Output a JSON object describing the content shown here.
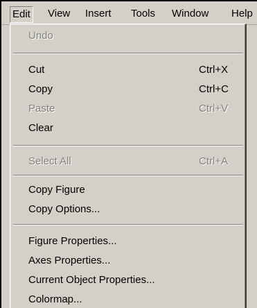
{
  "menubar": {
    "items": [
      {
        "label": "Edit"
      },
      {
        "label": "View"
      },
      {
        "label": "Insert"
      },
      {
        "label": "Tools"
      },
      {
        "label": "Window"
      },
      {
        "label": "Help"
      }
    ]
  },
  "edit_menu": {
    "undo": {
      "label": "Undo",
      "enabled": false
    },
    "cut": {
      "label": "Cut",
      "shortcut": "Ctrl+X",
      "enabled": true
    },
    "copy": {
      "label": "Copy",
      "shortcut": "Ctrl+C",
      "enabled": true
    },
    "paste": {
      "label": "Paste",
      "shortcut": "Ctrl+V",
      "enabled": false
    },
    "clear": {
      "label": "Clear",
      "enabled": true
    },
    "select_all": {
      "label": "Select All",
      "shortcut": "Ctrl+A",
      "enabled": false
    },
    "copy_figure": {
      "label": "Copy Figure",
      "enabled": true
    },
    "copy_options": {
      "label": "Copy Options...",
      "enabled": true
    },
    "figure_properties": {
      "label": "Figure Properties...",
      "enabled": true
    },
    "axes_properties": {
      "label": "Axes Properties...",
      "enabled": true
    },
    "current_object_properties": {
      "label": "Current Object Properties...",
      "enabled": true
    },
    "colormap": {
      "label": "Colormap...",
      "enabled": true
    }
  },
  "colors": {
    "menu_background": "#d4d0c8",
    "disabled_text": "#808080"
  }
}
